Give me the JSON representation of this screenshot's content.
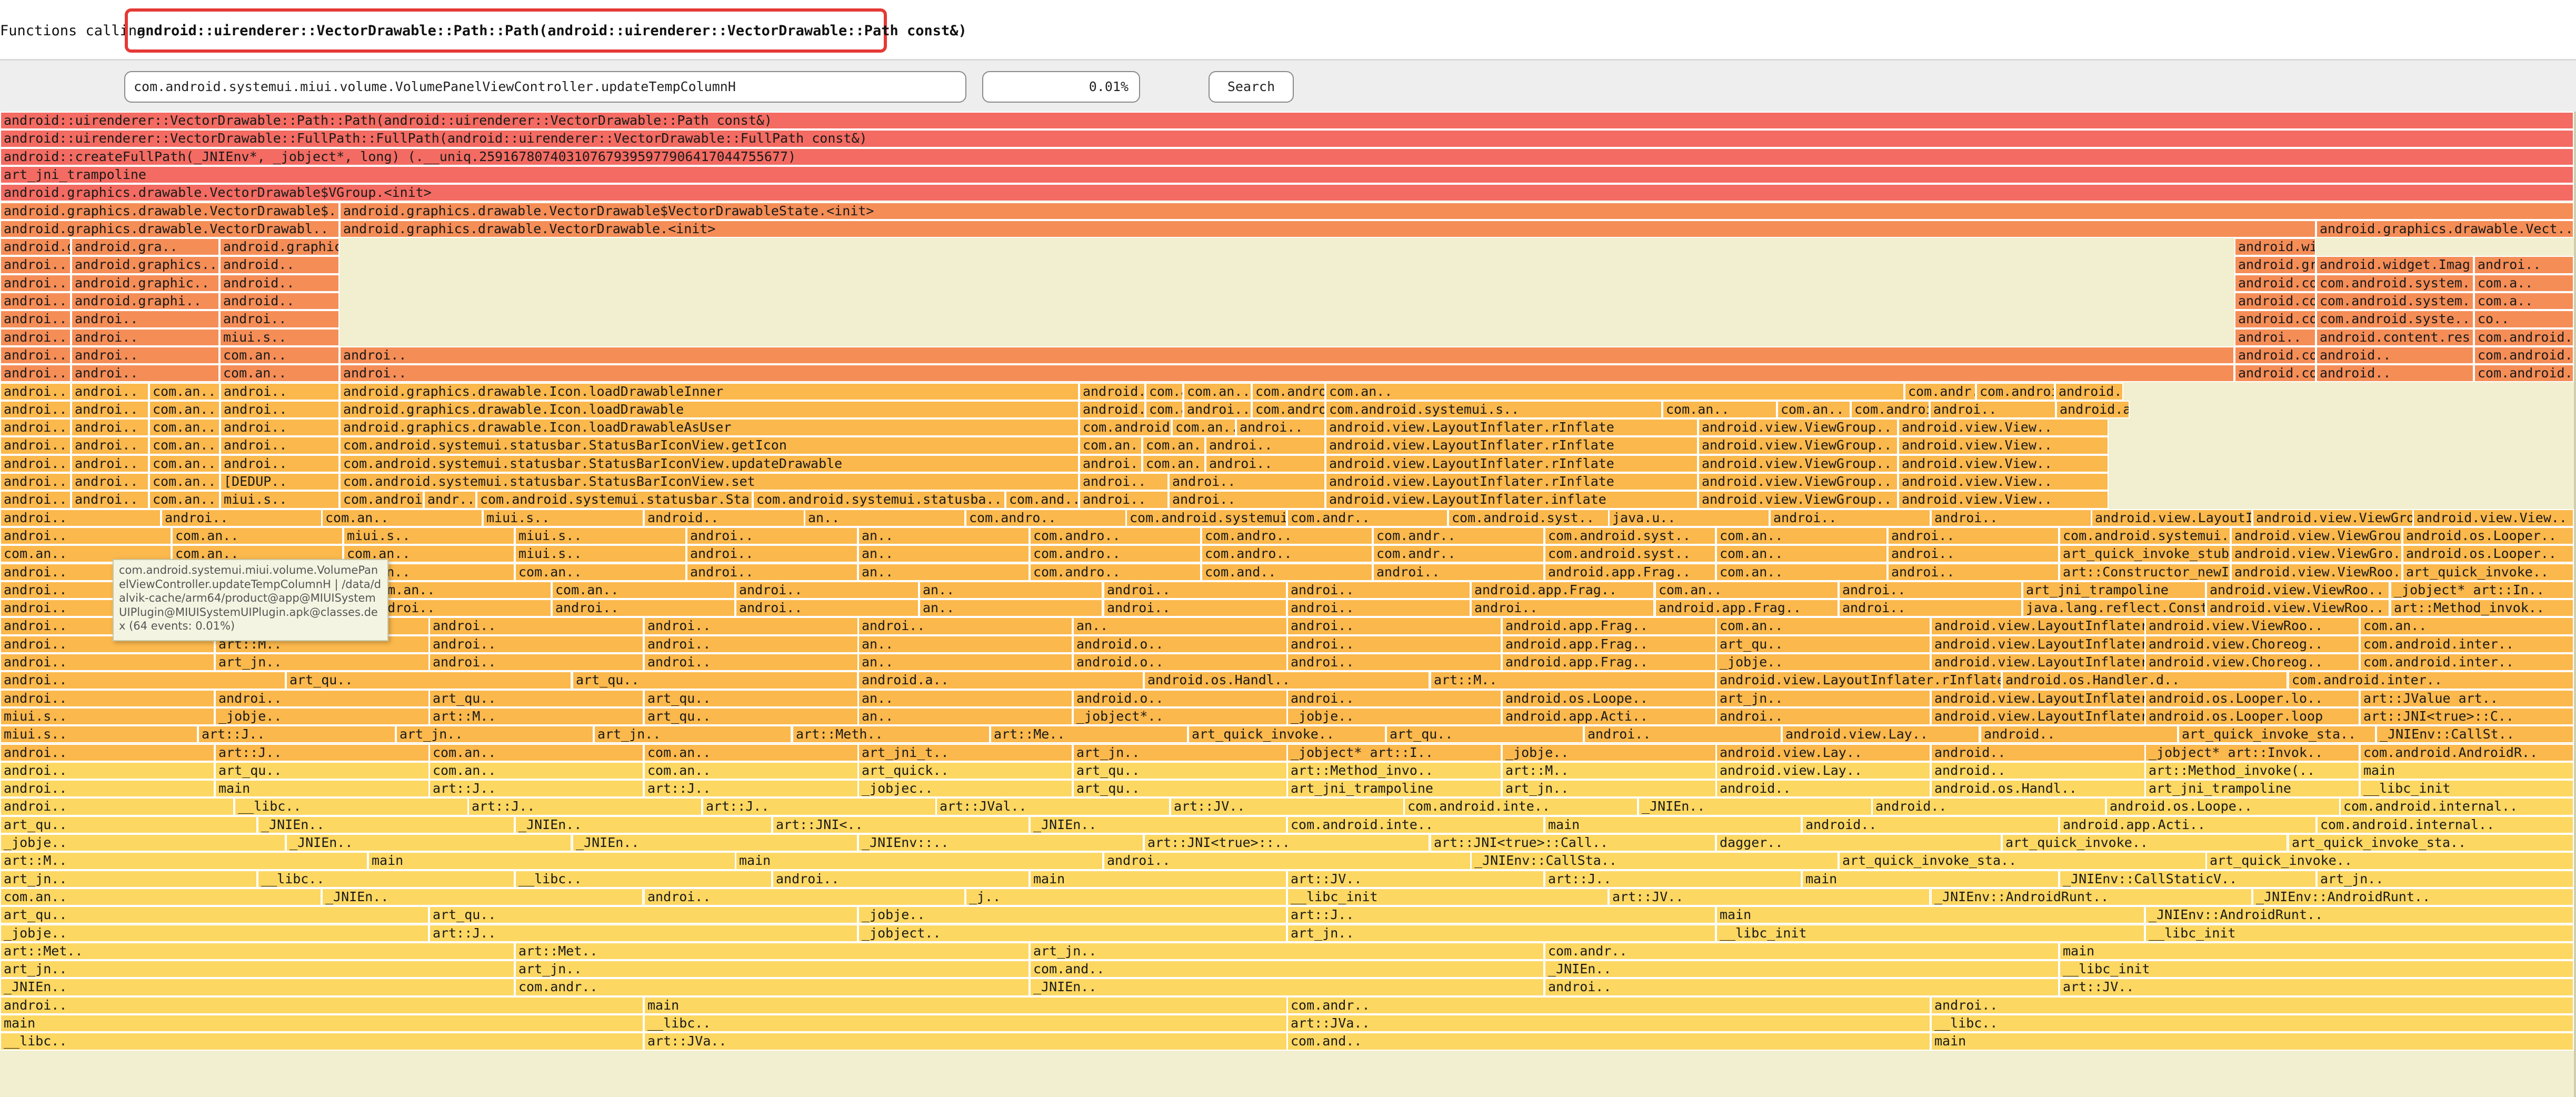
{
  "title": {
    "prefix": "Functions calling",
    "function": "android::uirenderer::VectorDrawable::Path::Path(android::uirenderer::VectorDrawable::Path const&)"
  },
  "toolbar": {
    "filter_value": "com.android.systemui.miui.volume.VolumePanelViewController.updateTempColumnH",
    "percent": "0.01%",
    "search_label": "Search"
  },
  "tooltip": {
    "text": "com.android.systemui.miui.volume.VolumePanelViewController.updateTempColumnH | /data/dalvik-cache/arm64/product@app@MIUISystemUIPlugin@MIUISystemUIPlugin.apk@classes.dex (64 events: 0.01%)"
  },
  "palette": {
    "top": "#f36b62",
    "upper": "#f58d57",
    "mid": "#fbb84c",
    "low": "#fcd762",
    "background": "#f1efcf",
    "highlight": "#e53935"
  },
  "frames": [
    [
      "android::uirenderer::VectorDrawable::Path::Path(android::uirenderer::VectorDrawable::Path const&)"
    ],
    [
      "android::uirenderer::VectorDrawable::FullPath::FullPath(android::uirenderer::VectorDrawable::FullPath const&)"
    ],
    [
      "android::createFullPath(_JNIEnv*, _jobject*, long) (.__uniq.259167807403107679395977906417044755677)"
    ],
    [
      "art_jni_trampoline"
    ],
    [
      "android.graphics.drawable.VectorDrawable$VGroup.<init>"
    ],
    [
      "android.graphics.drawable.VectorDrawable$..",
      "android.graphics.drawable.VectorDrawable$VectorDrawableState.<init>"
    ],
    [
      "android.graphics.drawable.VectorDrawabl..",
      "android.graphics.drawable.VectorDrawable.<init>",
      "android.graphics.drawable.Vect.."
    ],
    [
      "android.graphics.drawable..",
      "android.gra..",
      "android.graphics.drawable.VectorDrawable$VectorDrawableState.newDrawable",
      "android.widget.ImageView.apply.."
    ],
    [
      "androi..",
      "android.graphics..",
      "android..",
      "android.graphics.drawable.Drawable$ConstantState.newDrawable",
      "android.widget.Imag..",
      "androi.."
    ],
    [
      "androi..",
      "android.graphic..",
      "android..",
      "android.content.res.DrawableCache.getInstance",
      "com.android.system..",
      "com.a.."
    ],
    [
      "androi..",
      "android.graphi..",
      "android..",
      "android.content.res.ResourcesImpl.loadDrawable",
      "com.android.system..",
      "com.a.."
    ],
    [
      "androi..",
      "androi..",
      "androi..",
      "android.content.res.MiuiResourcesImpl.loadDrawable",
      "com.android.syste..",
      "co.."
    ],
    [
      "androi..",
      "androi..",
      "miui.s..",
      "androi..",
      "android.content.res.Resources.loadDrawable",
      "com.android.syste.."
    ],
    [
      "androi..",
      "androi..",
      "com.an..",
      "androi..",
      "android.content.res.Resources.getDrawableForDensity",
      "android..",
      "com.android.syste.."
    ],
    [
      "androi..",
      "androi..",
      "com.an..",
      "androi..",
      "android.content.res.Resources.getDrawable",
      "android..",
      "com.android.syste.."
    ],
    [
      "androi..",
      "androi..",
      "com.an..",
      "androi..",
      "android.graphics.drawable.Icon.loadDrawableInner",
      "android.widget..",
      "com.an..",
      "com.an..",
      "com.android.systemui.statusbar.views.MiuiBatteryMeterIconView.upd..",
      "com.an..",
      "com.andr..",
      "com.android.syste..",
      "android.."
    ],
    [
      "androi..",
      "androi..",
      "com.an..",
      "androi..",
      "android.graphics.drawable.Icon.loadDrawable",
      "android.widget..",
      "com.an..",
      "androi..",
      "com.android.systemui.statusbar.views.Miu..",
      "com.android.systemui.s..",
      "com.an..",
      "com.an..",
      "com.android.syste..",
      "androi..",
      "android.app.Fragm.."
    ],
    [
      "androi..",
      "androi..",
      "com.an..",
      "androi..",
      "android.graphics.drawable.Icon.loadDrawableAsUser",
      "com.android.sy..",
      "com.an..",
      "androi..",
      "android.view.LayoutInflater.rInflate",
      "android.view.ViewGroup..",
      "android.view.View.."
    ],
    [
      "androi..",
      "androi..",
      "com.an..",
      "androi..",
      "com.android.systemui.statusbar.StatusBarIconView.getIcon",
      "com.an..",
      "com.an..",
      "androi..",
      "android.view.LayoutInflater.rInflate",
      "android.view.ViewGroup..",
      "android.view.View.."
    ],
    [
      "androi..",
      "androi..",
      "com.an..",
      "androi..",
      "com.android.systemui.statusbar.StatusBarIconView.updateDrawable",
      "androi..",
      "com.an..",
      "androi..",
      "android.view.LayoutInflater.rInflate",
      "android.view.ViewGroup..",
      "android.view.View.."
    ],
    [
      "androi..",
      "androi..",
      "com.an..",
      "[DEDUP..",
      "com.android.systemui.statusbar.StatusBarIconView.set",
      "androi..",
      "androi..",
      "android.view.LayoutInflater.rInflate",
      "android.view.ViewGroup..",
      "android.view.View.."
    ],
    [
      "androi..",
      "androi..",
      "com.an..",
      "miui.s..",
      "com.android.v..",
      "andr..",
      "com.android.systemui.statusbar.Sta..",
      "com.android.systemui.statusba..",
      "com.and..",
      "androi..",
      "androi..",
      "android.view.LayoutInflater.inflate",
      "android.view.ViewGroup..",
      "android.view.View.."
    ],
    [
      "androi..",
      "androi..",
      "com.an..",
      "miui.s..",
      "android..",
      "an..",
      "com.andro..",
      "com.android.systemui..",
      "com.andr..",
      "com.android.syst..",
      "java.u..",
      "androi..",
      "androi..",
      "android.view.LayoutInflater.inflate",
      "android.view.ViewGrou..",
      "android.view.View.."
    ],
    [
      "androi..",
      "com.an..",
      "miui.s..",
      "miui.s..",
      "androi..",
      "an..",
      "com.andro..",
      "com.andro..",
      "com.andr..",
      "com.android.syst..",
      "com.an..",
      "androi..",
      "com.android.systemui.statusbar.views.Miu..",
      "android.view.ViewGrou..",
      "android.os.Looper.."
    ],
    [
      "com.an..",
      "com.an..",
      "com.an..",
      "miui.s..",
      "androi..",
      "an..",
      "com.andro..",
      "com.andro..",
      "com.andr..",
      "com.android.syst..",
      "com.an..",
      "androi..",
      "art_quick_invoke_stub",
      "android.view.ViewGro..",
      "android.os.Looper.."
    ],
    [
      "androi..",
      "com.an..",
      "com.an..",
      "com.an..",
      "androi..",
      "an..",
      "com.andro..",
      "com.and..",
      "androi..",
      "android.app.Frag..",
      "com.an..",
      "androi..",
      "art::Constructor_newInstance0(_JNIEnv*, ..",
      "android.view.ViewRoo..",
      "art_quick_invoke.."
    ],
    [
      "androi..",
      "androi..",
      "com.an..",
      "com.an..",
      "androi..",
      "an..",
      "androi..",
      "androi..",
      "android.app.Frag..",
      "com.an..",
      "androi..",
      "art_jni_trampoline",
      "android.view.ViewRoo..",
      "_jobject* art::In.."
    ],
    [
      "androi..",
      "androi..",
      "androi..",
      "androi..",
      "androi..",
      "an..",
      "androi..",
      "androi..",
      "androi..",
      "android.app.Frag..",
      "androi..",
      "java.lang.reflect.Constructor.newInstance",
      "android.view.ViewRoo..",
      "art::Method_invok.."
    ],
    [
      "androi..",
      "_jobje..",
      "androi..",
      "androi..",
      "androi..",
      "an..",
      "androi..",
      "android.app.Frag..",
      "com.an..",
      "android.view.LayoutInflater.createView",
      "android.view.ViewRoo..",
      "com.an.."
    ],
    [
      "androi..",
      "art::M..",
      "androi..",
      "androi..",
      "an..",
      "android.o..",
      "androi..",
      "android.app.Frag..",
      "art_qu..",
      "android.view.LayoutInflater.createViewFr..",
      "android.view.Choreog..",
      "com.android.inter.."
    ],
    [
      "androi..",
      "art_jn..",
      "androi..",
      "androi..",
      "an..",
      "android.o..",
      "androi..",
      "android.app.Frag..",
      "_jobje..",
      "android.view.LayoutInflater.parseInclude",
      "android.view.Choreog..",
      "com.android.inter.."
    ],
    [
      "androi..",
      "art_qu..",
      "art_qu..",
      "android.a..",
      "android.os.Handl..",
      "art::M..",
      "android.view.LayoutInflater.rInflate",
      "android.os.Handler.d..",
      "com.android.inter.."
    ],
    [
      "androi..",
      "androi..",
      "art_qu..",
      "art_qu..",
      "an..",
      "android.o..",
      "androi..",
      "android.os.Loope..",
      "art_jn..",
      "android.view.LayoutInflater.rInflate",
      "android.os.Looper.lo..",
      "art::JValue art.."
    ],
    [
      "miui.s..",
      "_jobje..",
      "art::M..",
      "art_qu..",
      "an..",
      "_jobject*..",
      "_jobje..",
      "android.app.Acti..",
      "androi..",
      "android.view.LayoutInflater.rIn..",
      "android.os.Looper.loop",
      "art::JNI<true>::C.."
    ],
    [
      "miui.s..",
      "art::J..",
      "art_jn..",
      "art_jn..",
      "art::Meth..",
      "art::Me..",
      "art_quick_invoke..",
      "art_qu..",
      "androi..",
      "android.view.Lay..",
      "android..",
      "art_quick_invoke_sta..",
      "_JNIEnv::CallSt.."
    ],
    [
      "androi..",
      "art::J..",
      "com.an..",
      "com.an..",
      "art_jni_t..",
      "art_jn..",
      "_jobject* art::I..",
      "_jobje..",
      "android.view.Lay..",
      "android..",
      "_jobject* art::Invok..",
      "com.android.AndroidR.."
    ],
    [
      "androi..",
      "art_qu..",
      "com.an..",
      "com.an..",
      "art_quick..",
      "art_qu..",
      "art::Method_invo..",
      "art::M..",
      "android.view.Lay..",
      "android..",
      "art::Method_invoke(..",
      "main"
    ],
    [
      "androi..",
      "main",
      "art::J..",
      "art::J..",
      "_jobjec..",
      "art_qu..",
      "art_jni_trampoline",
      "art_jn..",
      "android..",
      "android.os.Handl..",
      "art_jni_trampoline",
      "__libc_init"
    ],
    [
      "androi..",
      "__libc..",
      "art::J..",
      "art::J..",
      "art::JVal..",
      "art::JV..",
      "com.android.inte..",
      "_JNIEn..",
      "android..",
      "android.os.Loope..",
      "com.android.internal.."
    ],
    [
      "art_qu..",
      "_JNIEn..",
      "_JNIEn..",
      "art::JNI<..",
      "_JNIEn..",
      "com.android.inte..",
      "main",
      "android..",
      "android.app.Acti..",
      "com.android.internal.."
    ],
    [
      "_jobje..",
      "_JNIEn..",
      "_JNIEn..",
      "_JNIEnv::..",
      "art::JNI<true>::..",
      "art::JNI<true>::Call..",
      "dagger..",
      "art_quick_invoke..",
      "art_quick_invoke_sta.."
    ],
    [
      "art::M..",
      "main",
      "main",
      "androi..",
      "_JNIEnv::CallSta..",
      "art_quick_invoke_sta..",
      "art_quick_invoke.."
    ],
    [
      "art_jn..",
      "__libc..",
      "__libc..",
      "androi..",
      "main",
      "art::JV..",
      "art::J..",
      "main",
      "_JNIEnv::CallStaticV..",
      "art_jn.."
    ],
    [
      "com.an..",
      "_JNIEn..",
      "androi..",
      "_j..",
      "__libc_init",
      "art::JV..",
      "_JNIEnv::AndroidRunt..",
      "_JNIEnv::AndroidRunt.."
    ],
    [
      "art_qu..",
      "art_qu..",
      "_jobje..",
      "art::J..",
      "main",
      "_JNIEnv::AndroidRunt.."
    ],
    [
      "_jobje..",
      "art::J..",
      "_jobject..",
      "art_jn..",
      "__libc_init",
      "__libc_init"
    ],
    [
      "art::Met..",
      "art::Met..",
      "art_jn..",
      "com.andr..",
      "main"
    ],
    [
      "art_jn..",
      "art_jn..",
      "com.and..",
      "_JNIEn..",
      "__libc_init"
    ],
    [
      "_JNIEn..",
      "com.andr..",
      "_JNIEn..",
      "androi..",
      "art::JV.."
    ],
    [
      "androi..",
      "main",
      "com.andr..",
      "androi.."
    ],
    [
      "main",
      "__libc..",
      "art::JVa..",
      "__libc.."
    ],
    [
      "__libc..",
      "art::JVa..",
      "com.and..",
      "main"
    ]
  ]
}
